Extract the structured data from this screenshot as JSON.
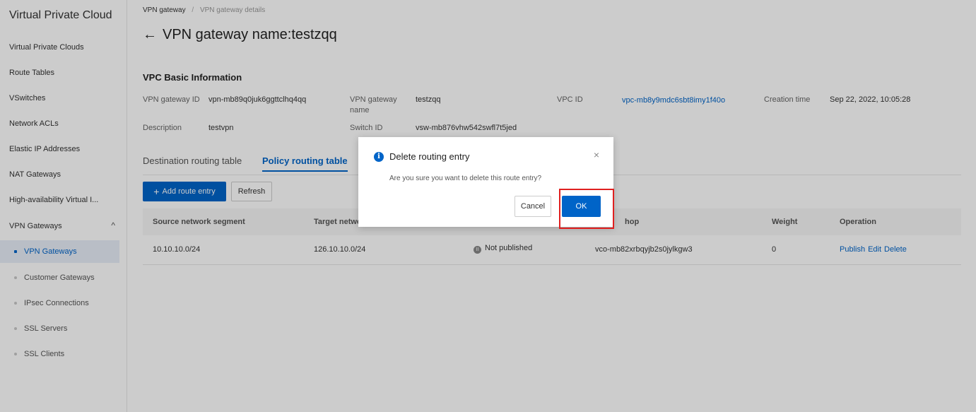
{
  "sidebar": {
    "title": "Virtual Private Cloud",
    "items": [
      "Virtual Private Clouds",
      "Route Tables",
      "VSwitches",
      "Network ACLs",
      "Elastic IP Addresses",
      "NAT Gateways",
      "High-availability Virtual I..."
    ],
    "group": {
      "label": "VPN Gateways",
      "chevron": "^"
    },
    "subitems": [
      "VPN Gateways",
      "Customer Gateways",
      "IPsec Connections",
      "SSL Servers",
      "SSL Clients"
    ]
  },
  "breadcrumb": {
    "parent": "VPN gateway",
    "separator": "/",
    "current": "VPN gateway details"
  },
  "page": {
    "back": "←",
    "title": "VPN gateway name:testzqq"
  },
  "basic_info": {
    "title": "VPC Basic Information",
    "vpn_gateway_id_label": "VPN gateway ID",
    "vpn_gateway_id": "vpn-mb89q0juk6ggttclhq4qq",
    "vpn_gateway_name_label_1": "VPN gateway",
    "vpn_gateway_name_label_2": "name",
    "vpn_gateway_name": "testzqq",
    "vpc_id_label": "VPC ID",
    "vpc_id": "vpc-mb8y9mdc6sbt8imy1f40o",
    "creation_time_label": "Creation time",
    "creation_time": "Sep 22, 2022, 10:05:28",
    "description_label": "Description",
    "description": "testvpn",
    "switch_id_label": "Switch ID",
    "switch_id": "vsw-mb876vhw542swfl7t5jed"
  },
  "tabs": [
    "Destination routing table",
    "Policy routing table"
  ],
  "toolbar": {
    "add_label": "Add route entry",
    "add_icon": "+",
    "refresh_label": "Refresh"
  },
  "table": {
    "headers": {
      "source": "Source network segment",
      "target": "Target netwo",
      "next_hop": "hop",
      "weight": "Weight",
      "operation": "Operation"
    },
    "rows": [
      {
        "source": "10.10.10.0/24",
        "target": "126.10.10.0/24",
        "status": "Not published",
        "next_hop": "vco-mb82xrbqyjb2s0jylkgw3",
        "weight": "0",
        "ops": [
          "Publish",
          "Edit",
          "Delete"
        ]
      }
    ]
  },
  "dialog": {
    "icon": "i",
    "title": "Delete routing entry",
    "close": "×",
    "message": "Are you sure you want to delete this route entry?",
    "cancel_label": "Cancel",
    "ok_label": "OK"
  },
  "colors": {
    "accent": "#0064c8",
    "highlight": "#e02020",
    "active_bg": "#e8eef8"
  }
}
